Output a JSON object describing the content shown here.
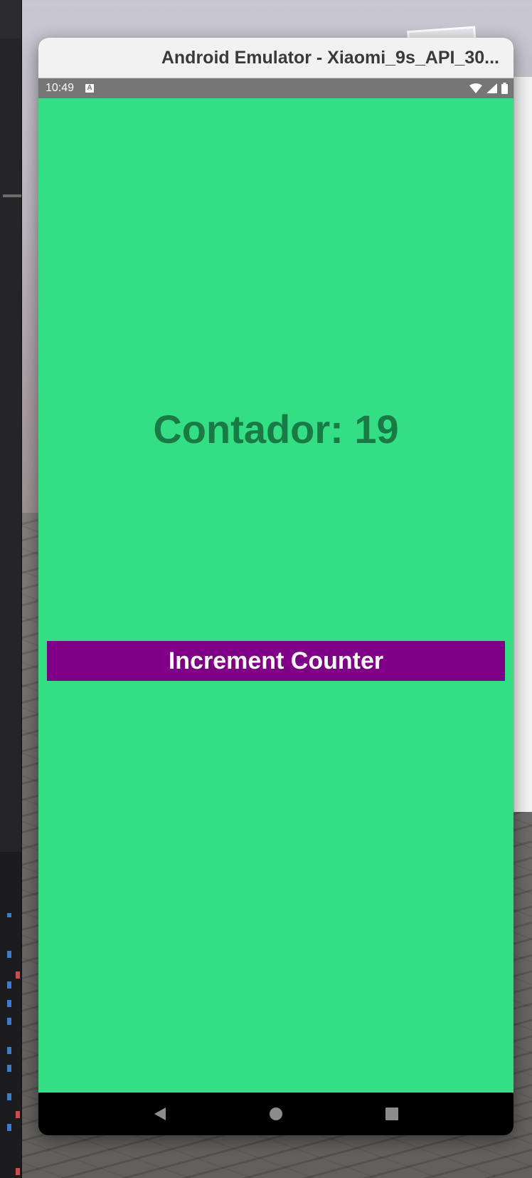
{
  "window": {
    "title": "Android Emulator - Xiaomi_9s_API_30..."
  },
  "status_bar": {
    "time": "10:49",
    "notification_glyph": "A",
    "icons": [
      "wifi-icon",
      "signal-icon",
      "battery-icon"
    ]
  },
  "app": {
    "counter_text": "Contador: 19",
    "increment_button_label": "Increment Counter",
    "colors": {
      "background": "#33de84",
      "counter_text": "#1a7a45",
      "button": "#7f0087",
      "button_text": "#ffffff"
    }
  },
  "nav_bar": {
    "buttons": [
      "back-icon",
      "home-icon",
      "recents-icon"
    ]
  }
}
